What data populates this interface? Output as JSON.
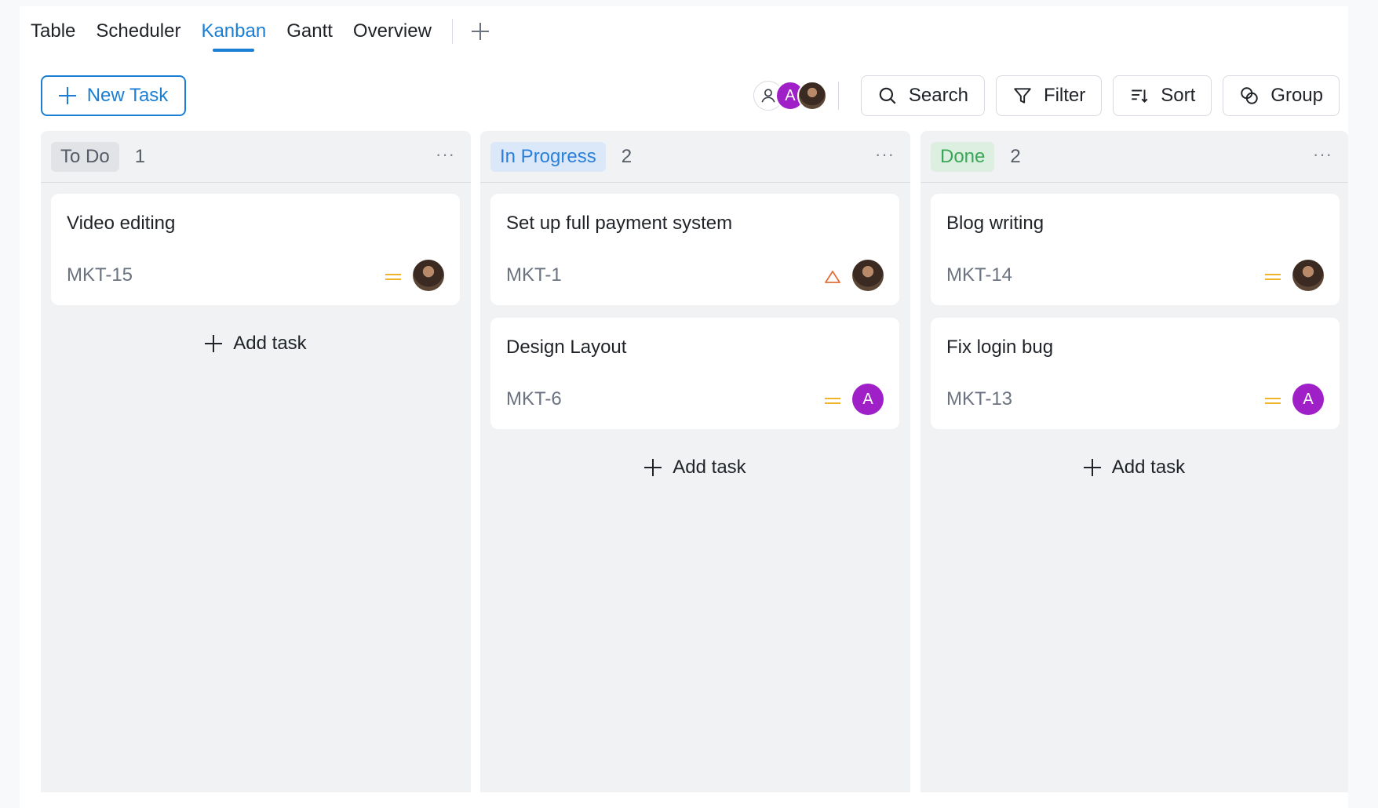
{
  "tabs": [
    {
      "label": "Table",
      "active": false
    },
    {
      "label": "Scheduler",
      "active": false
    },
    {
      "label": "Kanban",
      "active": true
    },
    {
      "label": "Gantt",
      "active": false
    },
    {
      "label": "Overview",
      "active": false
    }
  ],
  "toolbar": {
    "new_task_label": "New Task",
    "search_label": "Search",
    "filter_label": "Filter",
    "sort_label": "Sort",
    "group_label": "Group",
    "avatar_letter": "A"
  },
  "columns": [
    {
      "status": "To Do",
      "count": "1",
      "cards": [
        {
          "title": "Video editing",
          "key": "MKT-15",
          "priority": "medium",
          "assignee": "photo"
        }
      ],
      "add_label": "Add task"
    },
    {
      "status": "In Progress",
      "count": "2",
      "cards": [
        {
          "title": "Set up full payment system",
          "key": "MKT-1",
          "priority": "high",
          "assignee": "photo"
        },
        {
          "title": "Design Layout",
          "key": "MKT-6",
          "priority": "medium",
          "assignee": "A"
        }
      ],
      "add_label": "Add task"
    },
    {
      "status": "Done",
      "count": "2",
      "cards": [
        {
          "title": "Blog writing",
          "key": "MKT-14",
          "priority": "medium",
          "assignee": "photo"
        },
        {
          "title": "Fix login bug",
          "key": "MKT-13",
          "priority": "medium",
          "assignee": "A"
        }
      ],
      "add_label": "Add task"
    }
  ],
  "colors": {
    "accent": "#1a7fd4",
    "priority_medium": "#f0b429",
    "priority_high": "#e0703a",
    "avatar_purple": "#a020c8"
  }
}
